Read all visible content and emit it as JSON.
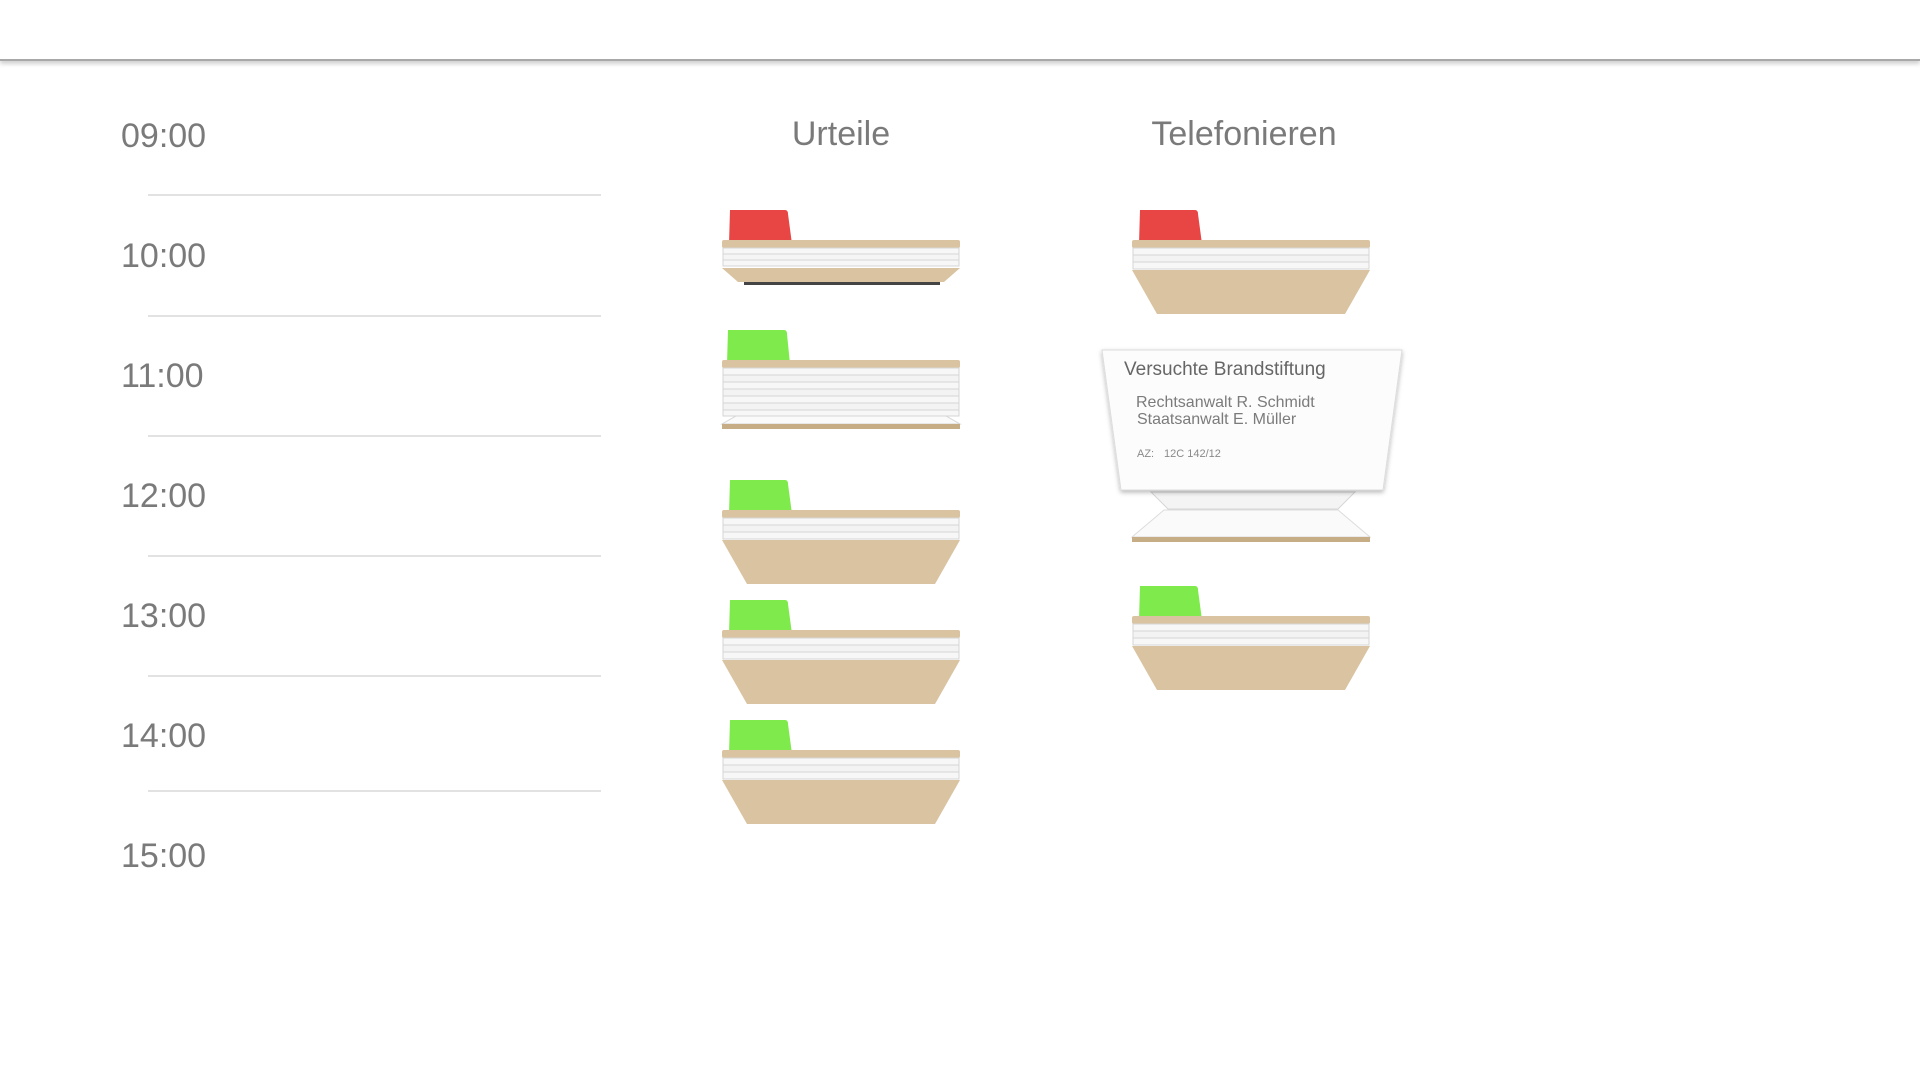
{
  "timeline": {
    "hours": [
      "09:00",
      "10:00",
      "11:00",
      "12:00",
      "13:00",
      "14:00",
      "15:00"
    ]
  },
  "columns": [
    {
      "title": "Urteile",
      "folders": [
        {
          "tab_color": "#e84545",
          "status": "red"
        },
        {
          "tab_color": "#7eea4b",
          "status": "green"
        },
        {
          "tab_color": "#7eea4b",
          "status": "green"
        },
        {
          "tab_color": "#7eea4b",
          "status": "green"
        },
        {
          "tab_color": "#7eea4b",
          "status": "green"
        }
      ]
    },
    {
      "title": "Telefonieren",
      "folders": [
        {
          "tab_color": "#e84545",
          "status": "red"
        },
        {
          "tab_color": "none",
          "status": "open"
        },
        {
          "tab_color": "#7eea4b",
          "status": "green"
        }
      ]
    }
  ],
  "open_case": {
    "title": "Versuchte Brandstiftung",
    "lawyer": "Rechtsanwalt R. Schmidt",
    "prosecutor": "Staatsanwalt E. Müller",
    "az_label": "AZ:",
    "az_value": "12C 142/12"
  },
  "colors": {
    "folder_body": "#d9c3a0",
    "folder_edge": "#c7ad85",
    "tab_red": "#e84545",
    "tab_green": "#7eea4b",
    "text_gray": "#7a7a7a"
  }
}
